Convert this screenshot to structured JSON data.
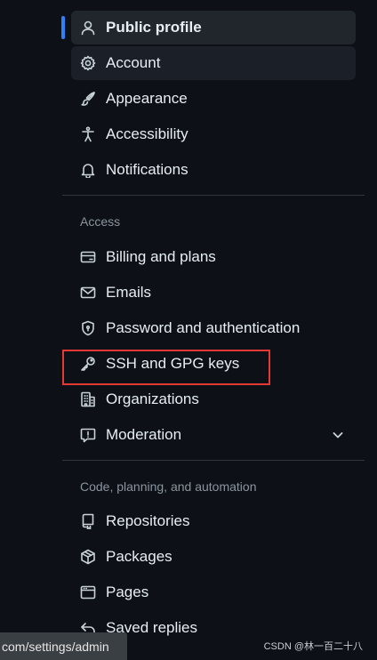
{
  "nav": {
    "top_items": [
      {
        "label": "Public profile",
        "icon": "person-icon"
      },
      {
        "label": "Account",
        "icon": "gear-icon"
      },
      {
        "label": "Appearance",
        "icon": "paintbrush-icon"
      },
      {
        "label": "Accessibility",
        "icon": "accessibility-icon"
      },
      {
        "label": "Notifications",
        "icon": "bell-icon"
      }
    ],
    "access": {
      "title": "Access",
      "items": [
        {
          "label": "Billing and plans",
          "icon": "credit-card-icon"
        },
        {
          "label": "Emails",
          "icon": "mail-icon"
        },
        {
          "label": "Password and authentication",
          "icon": "shield-lock-icon"
        },
        {
          "label": "SSH and GPG keys",
          "icon": "key-icon"
        },
        {
          "label": "Organizations",
          "icon": "organization-icon"
        },
        {
          "label": "Moderation",
          "icon": "report-icon"
        }
      ]
    },
    "code": {
      "title": "Code, planning, and automation",
      "items": [
        {
          "label": "Repositories",
          "icon": "repo-icon"
        },
        {
          "label": "Packages",
          "icon": "package-icon"
        },
        {
          "label": "Pages",
          "icon": "browser-icon"
        },
        {
          "label": "Saved replies",
          "icon": "reply-icon"
        }
      ]
    }
  },
  "status_url": "com/settings/admin",
  "watermark": "CSDN @林一百二十八",
  "colors": {
    "background": "#0d1117",
    "active_bar": "#2f81f7",
    "highlight": "#e53935"
  }
}
